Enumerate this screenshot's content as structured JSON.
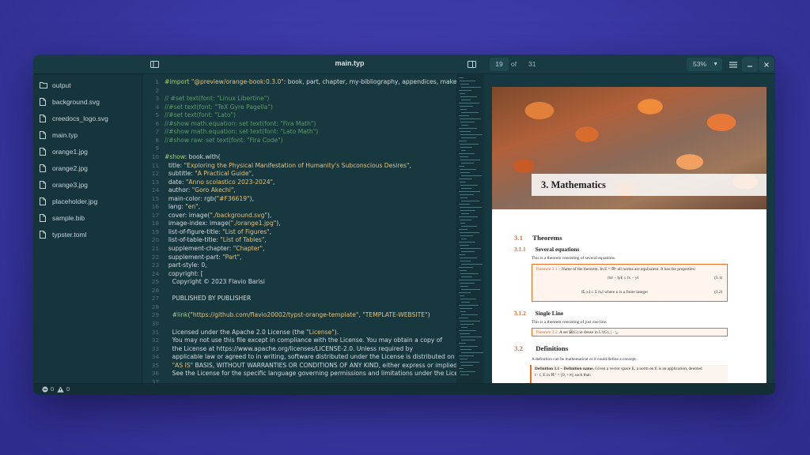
{
  "window": {
    "title": "main.typ"
  },
  "toolbar": {
    "page_current": "19",
    "page_of": "of",
    "page_total": "31",
    "zoom": "53%"
  },
  "sidebar": {
    "files": [
      {
        "name": "output",
        "type": "folder"
      },
      {
        "name": "background.svg",
        "type": "file"
      },
      {
        "name": "creedocs_logo.svg",
        "type": "file"
      },
      {
        "name": "main.typ",
        "type": "file"
      },
      {
        "name": "orange1.jpg",
        "type": "file"
      },
      {
        "name": "orange2.jpg",
        "type": "file"
      },
      {
        "name": "orange3.jpg",
        "type": "file"
      },
      {
        "name": "placeholder.jpg",
        "type": "file"
      },
      {
        "name": "sample.bib",
        "type": "file"
      },
      {
        "name": "typster.toml",
        "type": "file"
      }
    ]
  },
  "editor": {
    "line_numbers": [
      "1",
      "2",
      "3",
      "4",
      "5",
      "6",
      "7",
      "8",
      "9",
      "10",
      "11",
      "12",
      "13",
      "14",
      "15",
      "16",
      "17",
      "18",
      "19",
      "20",
      "21",
      "22",
      "23",
      "24",
      "25",
      "26",
      "27",
      "28",
      "29",
      "30",
      "31",
      "32",
      "33",
      "34",
      "35",
      "36",
      "37"
    ],
    "lines": [
      "#import \"@preview/orange-book:0.3.0\": book, part, chapter, my-bibliography, appendices, make-index",
      "",
      "// #set text(font: \"Linux Libertine\")",
      "//#set text(font: \"TeX Gyre Pagella\")",
      "//#set text(font: \"Lato\")",
      "//#show math.equation: set text(font: \"Fira Math\")",
      "//#show math.equation: set text(font: \"Lato Math\")",
      "//#show raw: set text(font: \"Fira Code\")",
      "",
      "#show: book.with(",
      "  title: \"Exploring the Physical Manifestation of Humanity's Subconscious Desires\",",
      "  subtitle: \"A Practical Guide\",",
      "  date: \"Anno scolastico 2023-2024\",",
      "  author: \"Goro Akechi\",",
      "  main-color: rgb(\"#F36619\"),",
      "  lang: \"en\",",
      "  cover: image(\"./background.svg\"),",
      "  image-index: image(\"./orange1.jpg\"),",
      "  list-of-figure-title: \"List of Figures\",",
      "  list-of-table-title: \"List of Tables\",",
      "  supplement-chapter: \"Chapter\",",
      "  supplement-part: \"Part\",",
      "  part-style: 0,",
      "  copyright: [",
      "    Copyright © 2023 Flavio Barisi",
      "",
      "    PUBLISHED BY PUBLISHER",
      "",
      "    #link(\"https://github.com/flavio20002/typst-orange-template\", \"TEMPLATE-WEBSITE\")",
      "",
      "    Licensed under the Apache 2.0 License (the \"License\").",
      "    You may not use this file except in compliance with the License. You may obtain a copy of",
      "    the License at https://www.apache.org/licenses/LICENSE-2.0. Unless required by",
      "    applicable law or agreed to in writing, software distributed under the License is distributed on an",
      "    \"AS IS\" BASIS, WITHOUT WARRANTIES OR CONDITIONS OF ANY KIND, either express or implied.",
      "    See the License for the specific language governing permissions and limitations under the License.",
      ""
    ]
  },
  "preview": {
    "chapter_title": "3. Mathematics",
    "sec_3_1_num": "3.1",
    "sec_3_1_title": "Theorems",
    "sec_3_1_1_num": "3.1.1",
    "sec_3_1_1_title": "Several equations",
    "sec_3_1_1_body": "This is a theorem consisting of several equations.",
    "thm_1_label": "Theorem 3.1",
    "thm_1_text": " – Name of the theorem. In E = ℝⁿ all norms are equivalent. It has the properties:",
    "eq_1": "|‖x‖ − ‖y‖| ≤ ‖x − y‖",
    "eq_1_num": "(3.1)",
    "eq_2": "‖Σ xᵢ‖ ≤ Σ ‖xᵢ‖   where n is a finite integer",
    "eq_2_num": "(3.2)",
    "sec_3_1_2_num": "3.1.2",
    "sec_3_1_2_title": "Single Line",
    "sec_3_1_2_body": "This is a theorem consisting of just one line.",
    "thm_2_label": "Theorem 3.2.",
    "thm_2_text": " A set 𝒟(G) in dense in L²(G), | · |₀.",
    "sec_3_2_num": "3.2",
    "sec_3_2_title": "Definitions",
    "sec_3_2_body": "A definition can be mathematical or it could define a concept.",
    "def_label": "Definition 3.1 – Definition name.",
    "def_text": " Given a vector space E, a norm on E is an application, denoted",
    "def_text2": "‖ · ‖, E in ℝ⁺ = [0, +∞[ such that:"
  },
  "statusbar": {
    "errors": "0",
    "warnings": "0"
  },
  "colors": {
    "accent": "#e56e2b",
    "window_bg": "#16323a",
    "editor_bg": "#183840"
  }
}
